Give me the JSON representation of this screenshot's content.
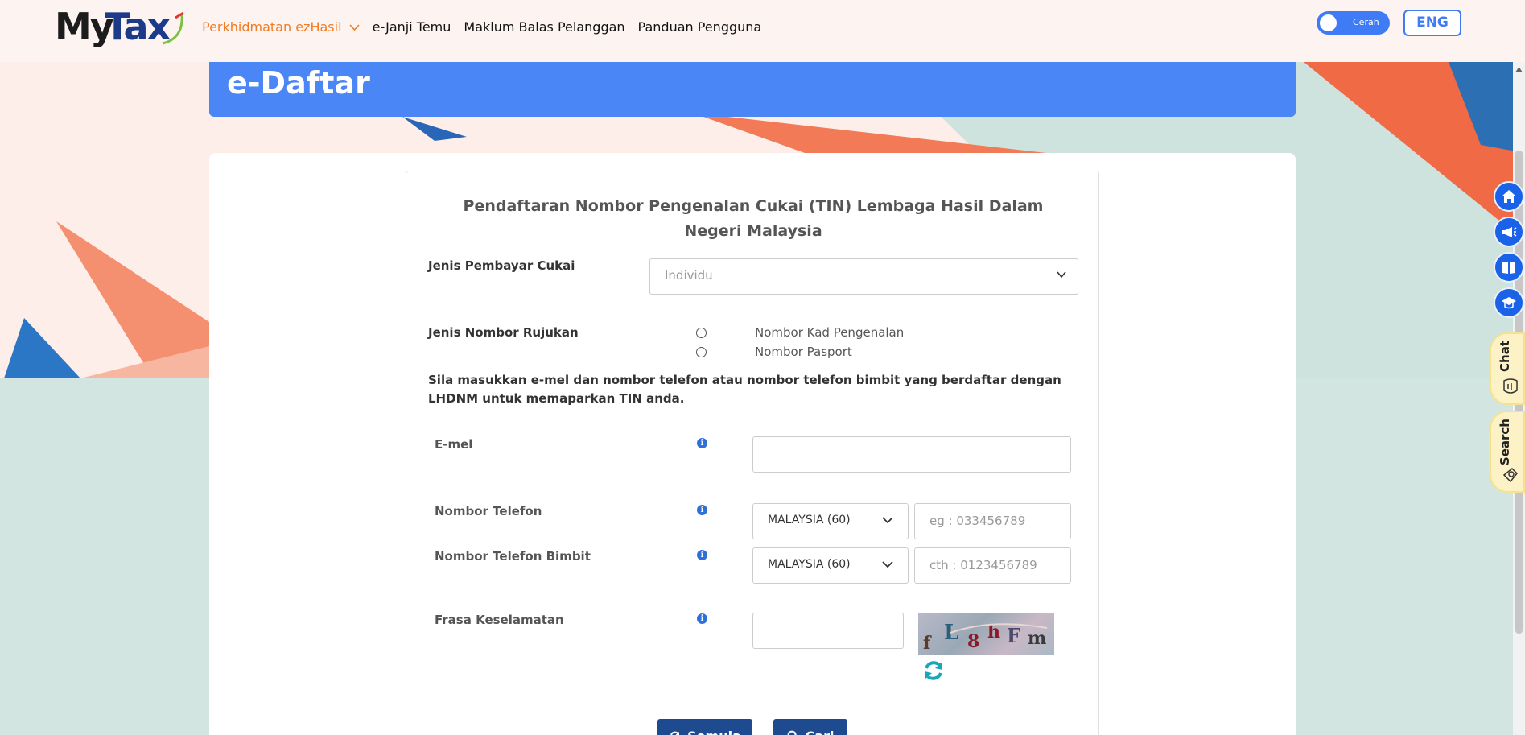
{
  "header": {
    "logo_my": "My",
    "logo_tax": "Tax",
    "nav": [
      {
        "label": "Perkhidmatan ezHasil",
        "active": true
      },
      {
        "label": "e-Janji Temu"
      },
      {
        "label": "Maklum Balas Pelanggan"
      },
      {
        "label": "Panduan Pengguna"
      }
    ],
    "theme_toggle_label": "Cerah",
    "lang_button": "ENG"
  },
  "banner": {
    "title": "e-Daftar"
  },
  "form": {
    "title": "Pendaftaran Nombor Pengenalan Cukai (TIN) Lembaga Hasil Dalam Negeri Malaysia",
    "taxpayer_type_label": "Jenis Pembayar Cukai",
    "taxpayer_type_value": "Individu",
    "ref_type_label": "Jenis Nombor Rujukan",
    "ref_options": [
      "Nombor Kad Pengenalan",
      "Nombor Pasport"
    ],
    "note": "Sila masukkan e-mel dan nombor telefon atau nombor telefon bimbit yang berdaftar dengan LHDNM untuk memaparkan TIN anda.",
    "email_label": "E-mel",
    "phone_label": "Nombor Telefon",
    "mobile_label": "Nombor Telefon Bimbit",
    "security_label": "Frasa Keselamatan",
    "country_value": "MALAYSIA (60)",
    "phone_placeholder": "eg : 033456789",
    "mobile_placeholder": "cth : 0123456789",
    "info_glyph": "i",
    "captcha_text": "fL8hFm",
    "reset_button": "Semula",
    "search_button": "Cari"
  },
  "side": {
    "chat_label": "Chat",
    "search_label": "Search"
  },
  "colors": {
    "accent_blue": "#4a86f6",
    "button_navy": "#1e4b8f",
    "nav_active": "#f07b25"
  }
}
